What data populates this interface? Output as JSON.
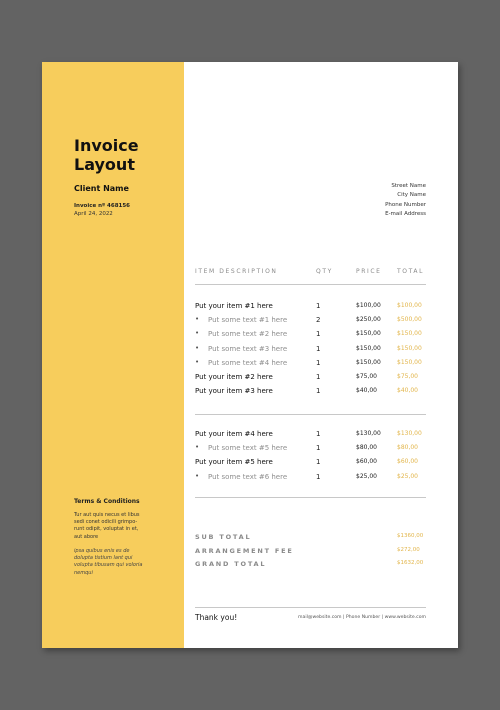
{
  "header": {
    "title_line1": "Invoice",
    "title_line2": "Layout",
    "client_name": "Client Name",
    "invoice_number": "Invoice nº 468156",
    "date": "April 24, 2022"
  },
  "address": {
    "street": "Street Name",
    "city": "City Name",
    "phone": "Phone Number",
    "email": "E-mail Address"
  },
  "table": {
    "columns": [
      "ITEM DESCRIPTION",
      "QTY",
      "PRICE",
      "TOTAL"
    ],
    "groups": [
      {
        "rows": [
          {
            "type": "item",
            "description": "Put your item #1 here",
            "qty": "1",
            "price": "$100,00",
            "total": "$100,00"
          },
          {
            "type": "sub",
            "description": "Put some text #1 here",
            "qty": "2",
            "price": "$250,00",
            "total": "$500,00"
          },
          {
            "type": "sub",
            "description": "Put some text #2 here",
            "qty": "1",
            "price": "$150,00",
            "total": "$150,00"
          },
          {
            "type": "sub",
            "description": "Put some text #3 here",
            "qty": "1",
            "price": "$150,00",
            "total": "$150,00"
          },
          {
            "type": "sub",
            "description": "Put some text #4 here",
            "qty": "1",
            "price": "$150,00",
            "total": "$150,00"
          },
          {
            "type": "item",
            "description": "Put your item #2 here",
            "qty": "1",
            "price": "$75,00",
            "total": "$75,00"
          },
          {
            "type": "item",
            "description": "Put your item #3 here",
            "qty": "1",
            "price": "$40,00",
            "total": "$40,00"
          }
        ]
      },
      {
        "rows": [
          {
            "type": "item",
            "description": "Put your item #4 here",
            "qty": "1",
            "price": "$130,00",
            "total": "$130,00"
          },
          {
            "type": "sub",
            "description": "Put some text #5 here",
            "qty": "1",
            "price": "$80,00",
            "total": "$80,00"
          },
          {
            "type": "item",
            "description": "Put your item #5 here",
            "qty": "1",
            "price": "$60,00",
            "total": "$60,00"
          },
          {
            "type": "sub",
            "description": "Put some text #6 here",
            "qty": "1",
            "price": "$25,00",
            "total": "$25,00"
          }
        ]
      }
    ]
  },
  "summary": [
    {
      "label": "SUB TOTAL",
      "value": "$1360,00"
    },
    {
      "label": "ARRANGEMENT FEE",
      "value": "$272,00"
    },
    {
      "label": "GRAND TOTAL",
      "value": "$1632,00"
    }
  ],
  "terms": {
    "heading": "Terms & Conditions",
    "paragraph1": "Tur aut quis necus et libus sedi conet odicili grimpo-runt odipit, voluptat in et, aut abore",
    "paragraph2": "ipsa quibus enis es de dolupta tistium lant qui volupta tibusam qui voloria nemqui"
  },
  "footer": {
    "thanks": "Thank you!",
    "contact": "mail@website.com | Phone Number | www.website.com"
  },
  "colors": {
    "accent": "#f7cd5c",
    "total_text": "#e2b54a",
    "background": "#636363"
  }
}
